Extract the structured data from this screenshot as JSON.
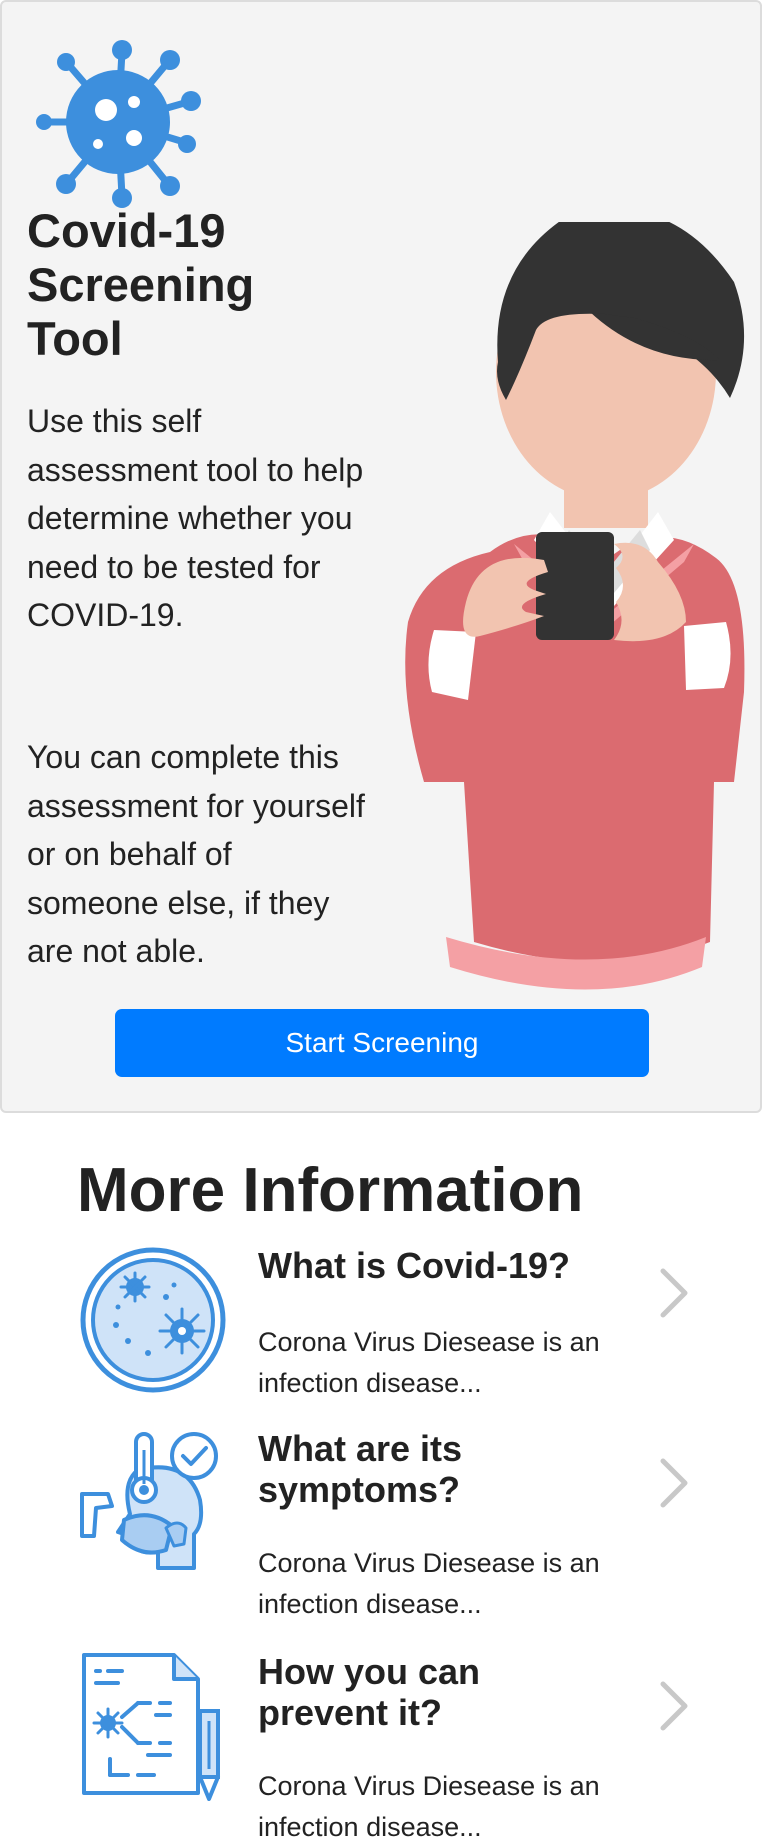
{
  "hero": {
    "title": "Covid-19 Screening Tool",
    "description": "Use this self assessment tool to help determine whether you need to be tested for COVID-19.",
    "note": "You can complete this assessment for yourself or on behalf of someone else, if they are not able.",
    "start_button_label": "Start Screening",
    "logo_icon": "virus-icon",
    "illustration": "person-holding-phone-illustration"
  },
  "more_info": {
    "title": "More Information",
    "items": [
      {
        "icon": "magnified-virus-icon",
        "heading": "What is Covid-19?",
        "summary": "Corona Virus Diesease is an infection disease..."
      },
      {
        "icon": "symptoms-thermometer-icon",
        "heading": "What are its symptoms?",
        "summary": "Corona Virus Diesease is an infection disease..."
      },
      {
        "icon": "prevention-document-icon",
        "heading": "How you can prevent it?",
        "summary": "Corona Virus Diesease is an infection disease..."
      }
    ]
  },
  "colors": {
    "accent": "#007bff",
    "icon_blue": "#3d8fdd",
    "card_background": "#f4f4f4",
    "sweater": "#db6b70",
    "hair": "#333333",
    "skin": "#f2c4b0"
  }
}
